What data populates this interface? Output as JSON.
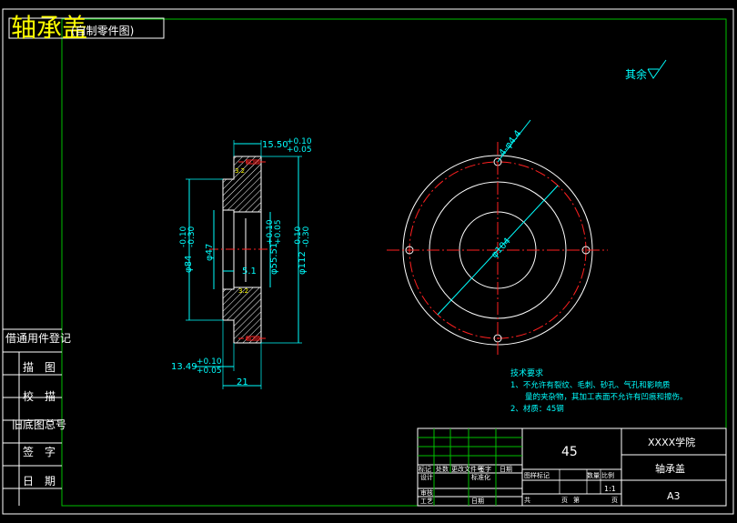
{
  "colors": {
    "background": "#000000",
    "frame": "#ffffff",
    "inner_frame": "#00c000",
    "dimension": "#00ffff",
    "geometry": "#ffffff",
    "centerline": "#ff2020",
    "hatch": "#ffffff",
    "title_text": "#ffff00",
    "cyan_text": "#00ffff"
  },
  "header": {
    "title": "轴承盖",
    "subtitle": "(自制零件图)"
  },
  "surface_finish": {
    "label": "其余"
  },
  "side_view": {
    "dim_top": {
      "value": "15.50",
      "upper": "+0.10",
      "lower": "+0.05"
    },
    "dim_phi84": {
      "value": "φ84",
      "upper": "-0.10",
      "lower": "-0.30"
    },
    "dim_phi47": {
      "value": "φ47"
    },
    "dim_51": {
      "value": "5.1"
    },
    "dim_phi55": {
      "value": "φ55.51",
      "upper": "+0.10",
      "lower": "+0.05"
    },
    "dim_phi112": {
      "value": "φ112",
      "upper": "-0.10",
      "lower": "-0.30"
    },
    "dim_1349": {
      "value": "13.49",
      "upper": "+0.10",
      "lower": "+0.05"
    },
    "dim_21": {
      "value": "21"
    },
    "rough_top": "3.2",
    "rough_mid": "3.2"
  },
  "front_view": {
    "hole_dim": "4-φ4.4",
    "circle_dim": "φ104"
  },
  "tech_requirements": {
    "heading": "技术要求",
    "items": [
      "1、不允许有裂纹、毛刺、砂孔、气孔和影响质",
      "量的夹杂物，其加工表面不允许有凹痕和擦伤。",
      "2、材质：45钢"
    ]
  },
  "left_panel": {
    "rows": [
      "借通用件登记",
      "描　图",
      "校　描",
      "旧底图总号",
      "签　字",
      "日　期"
    ]
  },
  "title_block": {
    "material": "45",
    "school": "XXXX学院",
    "part_name": "轴承盖",
    "sheet": "A3",
    "scale": "1:1",
    "row_labels": [
      "标记",
      "处数",
      "更改文件号",
      "签字",
      "日期"
    ],
    "design": "设计",
    "standard": "标准化",
    "review": "审核",
    "process": "工艺",
    "date": "日期",
    "stage_headers": [
      "图样标记",
      "数量",
      "比例"
    ],
    "total": "共",
    "sheet_word": "页",
    "page_no": "第",
    "page_word": "页"
  }
}
